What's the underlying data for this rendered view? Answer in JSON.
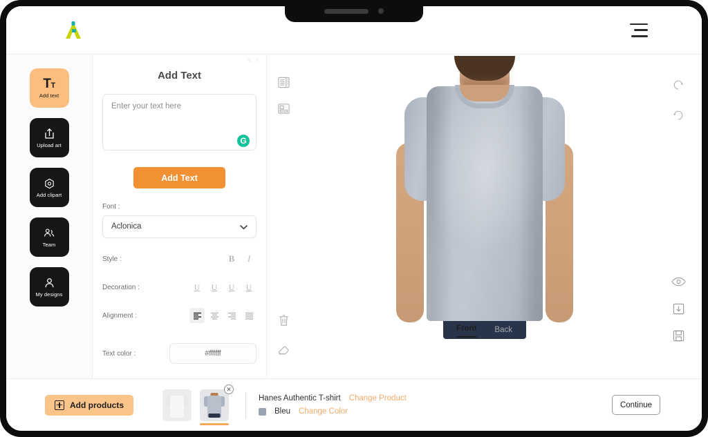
{
  "header": {
    "logo_name": "logo-a-icon",
    "menu_icon": "hamburger-menu-icon"
  },
  "tools": {
    "items": [
      {
        "label": "Add text",
        "icon": "text-tool-icon",
        "active": true
      },
      {
        "label": "Upload art",
        "icon": "upload-icon",
        "active": false
      },
      {
        "label": "Add clipart",
        "icon": "clipart-icon",
        "active": false
      },
      {
        "label": "Team",
        "icon": "team-icon",
        "active": false
      },
      {
        "label": "My designs",
        "icon": "my-designs-icon",
        "active": false
      }
    ]
  },
  "panel": {
    "title": "Add Text",
    "textarea_placeholder": "Enter your text here",
    "textarea_value": "",
    "grammarly_glyph": "G",
    "add_text_button": "Add Text",
    "font_label": "Font :",
    "font_value": "Aclonica",
    "style_label": "Style :",
    "style_options": [
      "B",
      "I"
    ],
    "decoration_label": "Decoration :",
    "decoration_options": [
      "U",
      "U",
      "U",
      "U"
    ],
    "alignment_label": "Alignment :",
    "alignment_options": [
      "align-left",
      "align-center",
      "align-right",
      "align-justify"
    ],
    "alignment_selected": 0,
    "text_color_label": "Text color :",
    "text_color_value": "#ffffff"
  },
  "canvas": {
    "left_tools": [
      "layers-icon",
      "templates-icon"
    ],
    "left_bottom_tools": [
      "trash-icon",
      "eraser-icon"
    ],
    "right_top_tools": [
      "undo-icon",
      "redo-icon"
    ],
    "right_bottom_tools": [
      "eye-icon",
      "download-icon",
      "save-icon"
    ],
    "views": [
      {
        "label": "Front",
        "active": true
      },
      {
        "label": "Back",
        "active": false
      }
    ],
    "shirt_color": "#b9c0cb"
  },
  "bottom": {
    "add_products_label": "Add products",
    "add_products_icon": "plus-box-icon",
    "thumbnails": [
      {
        "name": "white-tshirt-thumbnail",
        "color": "#f4f4f4",
        "selected": false
      },
      {
        "name": "blue-tshirt-thumbnail",
        "color": "#b9c0cb",
        "selected": true,
        "remove_icon": "✕"
      }
    ],
    "product_name": "Hanes Authentic T-shirt",
    "change_product_label": "Change Product",
    "color_name": "Bleu",
    "color_hex": "#9aa4b1",
    "change_color_label": "Change Color",
    "continue_label": "Continue"
  },
  "theme": {
    "accent_orange": "#f29133",
    "accent_light_orange": "#fbc489",
    "dark": "#161616",
    "grammarly_green": "#15c39a"
  }
}
